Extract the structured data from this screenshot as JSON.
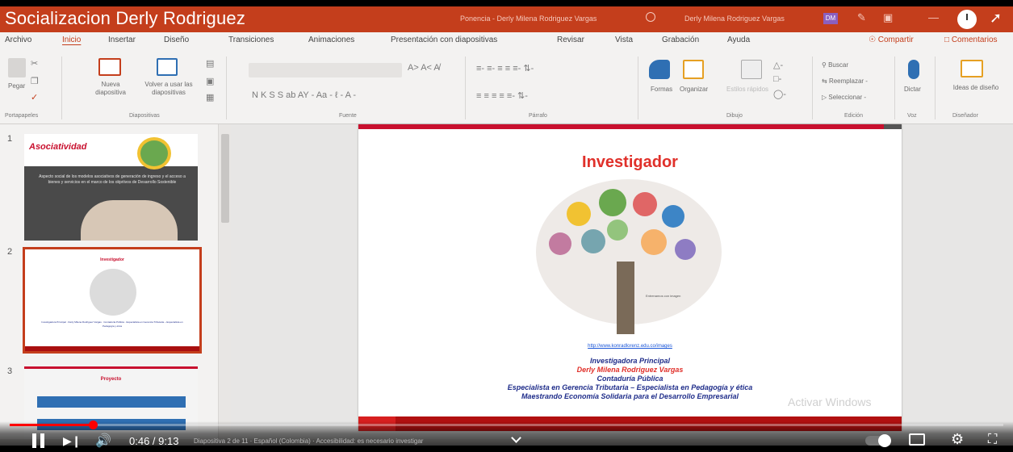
{
  "video": {
    "title": "Socializacion Derly Rodriguez",
    "time_readout": "0:46 / 9:13",
    "progress_fraction": 0.084,
    "chapter_text": "Diapositiva 2 de 11 · Español (Colombia) · Accesibilidad: es necesario investigar"
  },
  "titlebar": {
    "doc_name": "Ponencia - Derly Milena Rodriguez Vargas",
    "user_name": "Derly Milena Rodriguez Vargas",
    "user_initials": "DM"
  },
  "tabs": [
    {
      "label": "Archivo"
    },
    {
      "label": "Inicio"
    },
    {
      "label": "Insertar"
    },
    {
      "label": "Diseño"
    },
    {
      "label": "Transiciones"
    },
    {
      "label": "Animaciones"
    },
    {
      "label": "Presentación con diapositivas"
    },
    {
      "label": "Revisar"
    },
    {
      "label": "Vista"
    },
    {
      "label": "Grabación"
    },
    {
      "label": "Ayuda"
    }
  ],
  "tabs_right": {
    "share": "Compartir",
    "comments": "Comentarios"
  },
  "ribbon": {
    "paste": "Pegar",
    "new_slide": "Nueva diapositiva",
    "reuse_slide": "Volver a usar las diapositivas",
    "shapes": "Formas",
    "arrange": "Organizar",
    "quick_styles": "Estilos rápidos",
    "find": "Buscar",
    "replace": "Reemplazar",
    "select": "Seleccionar",
    "dictate": "Dictar",
    "design_ideas": "Ideas de diseño",
    "groups": {
      "clipboard": "Portapapeles",
      "slides": "Diapositivas",
      "font": "Fuente",
      "paragraph": "Párrafo",
      "drawing": "Dibujo",
      "editing": "Edición",
      "voice": "Voz",
      "designer": "Diseñador"
    }
  },
  "thumbnails": {
    "num1": "1",
    "num2": "2",
    "num3": "3",
    "slide1_title": "Asociatividad",
    "slide1_body": "Aspecto social de los modelos asociativos de generación de ingreso y el acceso a bienes y servicios en el marco de los objetivos de Desarrollo Sostenible",
    "slide2_title": "Investigador",
    "slide2_text": "Investigadora Principal · Derly Milena Rodriguez Vargas · Contaduría Pública · Especialista en Gerencia Tributaria – Especialista en Pedagogía y ética",
    "slide3_title": "Proyecto"
  },
  "slide": {
    "title": "Investigador",
    "tree_caption": "Entrenamos con imagen",
    "link": "http://www.konradlorenz.edu.co/images",
    "line1": "Investigadora Principal",
    "line2": "Derly Milena Rodriguez Vargas",
    "line3": "Contaduría Pública",
    "line4": "Especialista en Gerencia Tributaria – Especialista en Pedagogía y ética",
    "line5": "Maestrando Economía Solidaria para el Desarrollo Empresarial",
    "watermark": "Activar Windows"
  },
  "colors": {
    "ribbon_accent": "#c43e1c",
    "slide_red": "#e0302a",
    "slide_blue": "#1f2d8a",
    "progress_red": "#ff0000"
  }
}
